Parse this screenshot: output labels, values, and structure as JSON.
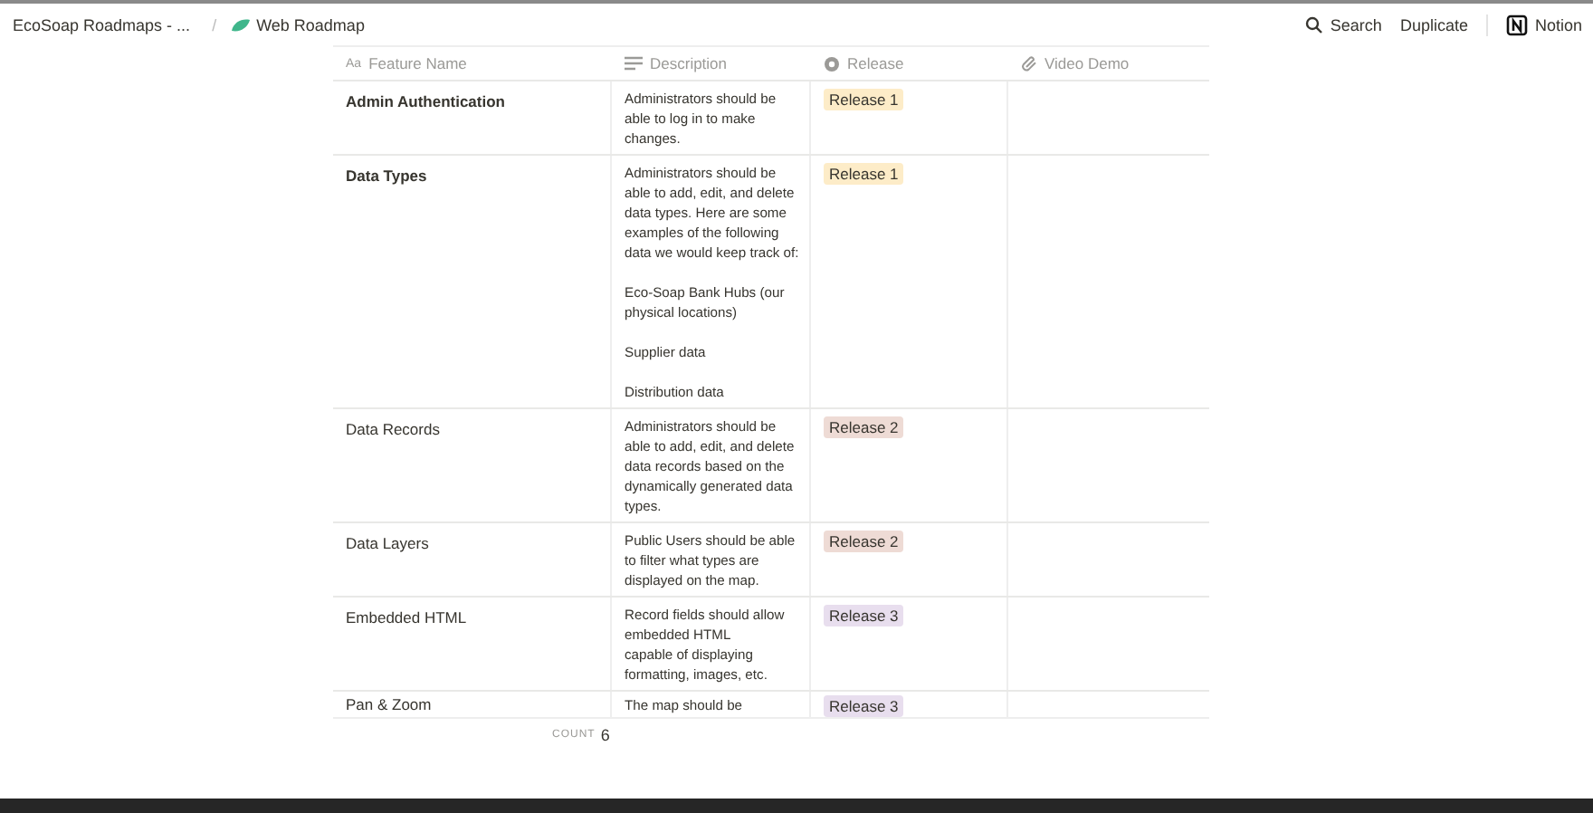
{
  "breadcrumb_separator": "/",
  "breadcrumbs": [
    {
      "label": "EcoSoap Roadmaps - ...",
      "kind": "text"
    },
    {
      "label": "Web Roadmap",
      "kind": "page"
    }
  ],
  "actions": [
    {
      "label": "Search",
      "kind": "search"
    },
    {
      "label": "Duplicate",
      "kind": "plain"
    },
    {
      "label": "Notion",
      "kind": "brand"
    }
  ],
  "table": {
    "columns": [
      {
        "label": "Feature Name",
        "kind": "title",
        "icon_text": "Aa"
      },
      {
        "label": "Description",
        "kind": "text"
      },
      {
        "label": "Release",
        "kind": "select"
      },
      {
        "label": "Video Demo",
        "kind": "url"
      }
    ],
    "rows": [
      {
        "name": "Admin Authentication",
        "bold": true,
        "description": "Administrators should be able to log in to make changes.",
        "release": {
          "label": "Release 1",
          "color": "#fdecc8"
        }
      },
      {
        "name": "Data Types",
        "bold": true,
        "description": "Administrators should be able to add, edit, and delete data types. Here are some examples of the following data we would keep track of:\n\nEco-Soap Bank Hubs (our physical locations)\n\nSupplier data\n\nDistribution data\n",
        "release": {
          "label": "Release 1",
          "color": "#fdecc8"
        }
      },
      {
        "name": "Data Records",
        "bold": false,
        "description": "Administrators should be able to add, edit, and delete data records based on the dynamically generated data types.",
        "release": {
          "label": "Release 2",
          "color": "#eedbd5"
        }
      },
      {
        "name": "Data Layers",
        "bold": false,
        "description": "Public Users should be able to filter what types are displayed on the map.",
        "release": {
          "label": "Release 2",
          "color": "#eedbd5"
        }
      },
      {
        "name": "Embedded HTML",
        "bold": false,
        "description": "Record fields should allow embedded HTML\ncapable of displaying formatting, images, etc.",
        "release": {
          "label": "Release 3",
          "color": "#e8deee"
        }
      },
      {
        "name": "Pan & Zoom",
        "bold": false,
        "description": "The map should be",
        "release": {
          "label": "Release 3",
          "color": "#e8deee"
        }
      }
    ]
  },
  "footer": {
    "label": "COUNT",
    "value": "6"
  }
}
